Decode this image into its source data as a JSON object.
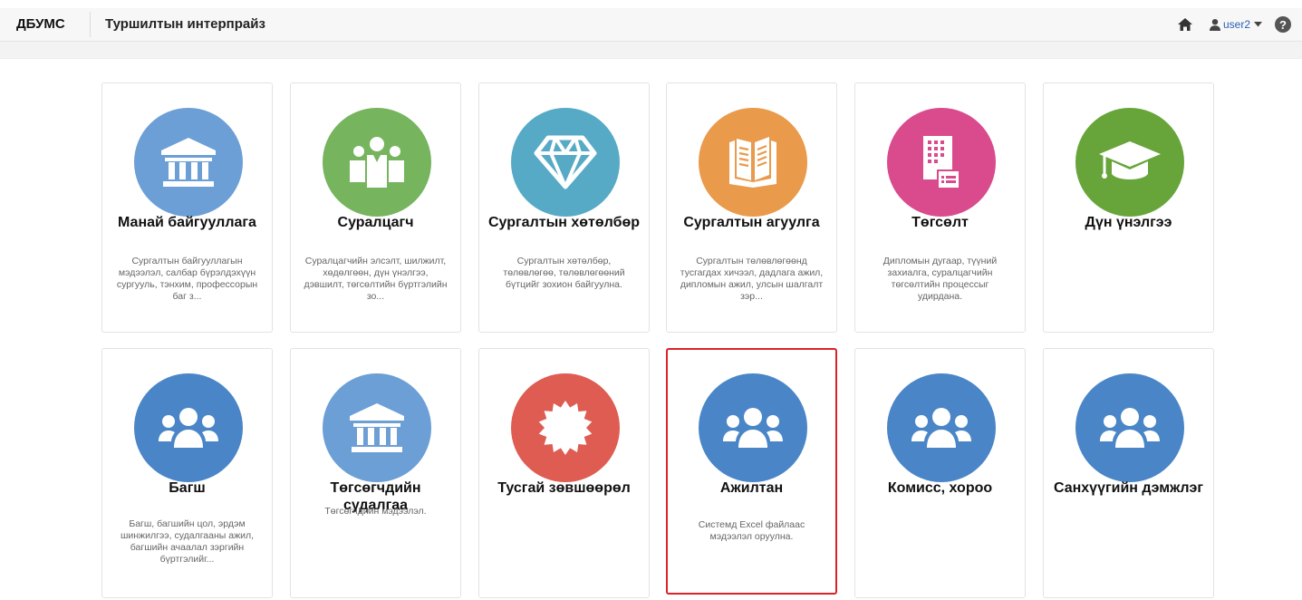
{
  "header": {
    "brand": "ДБУМС",
    "org_name": "Туршилтын интерпрайз",
    "user": "user2",
    "help": "?"
  },
  "colors": {
    "blue": "#4a86c7",
    "light_blue": "#6b9fd6",
    "green": "#76b45e",
    "teal": "#57aac6",
    "orange": "#e99a4a",
    "pink": "#d94b8c",
    "dark_green": "#67a53a",
    "red": "#de5c52",
    "selection_border": "#d9242a"
  },
  "cards": [
    {
      "title": "Манай байгууллага",
      "icon": "institution-icon",
      "color": "#6b9fd6",
      "desc": "Сургалтын байгууллагын мэдээлэл, салбар бүрэлдэхүүн сургууль, тэнхим, профессорын баг з..."
    },
    {
      "title": "Суралцагч",
      "icon": "students-icon",
      "color": "#76b45e",
      "desc": "Суралцагчийн элсэлт, шилжилт, хөдөлгөөн, дүн үнэлгээ, дэвшилт, төгсөлтийн бүртгэлийн зо..."
    },
    {
      "title": "Сургалтын хөтөлбөр",
      "icon": "diamond-icon",
      "color": "#57aac6",
      "desc": "Сургалтын хөтөлбөр, төлөвлөгөө, төлөвлөгөөний бүтцийг зохион байгуулна."
    },
    {
      "title": "Сургалтын агуулга",
      "icon": "book-icon",
      "color": "#e99a4a",
      "desc": "Сургалтын төлөвлөгөөнд тусгагдах хичээл, дадлага ажил, дипломын ажил, улсын шалгалт зэр..."
    },
    {
      "title": "Төгсөлт",
      "icon": "diploma-icon",
      "color": "#d94b8c",
      "desc": "Дипломын дугаар, түүний захиалга, суралцагчийн төгсөлтийн процессыг удирдана."
    },
    {
      "title": "Дүн үнэлгээ",
      "icon": "graduation-cap-icon",
      "color": "#67a53a",
      "desc": ""
    },
    {
      "title": "Багш",
      "icon": "users-icon",
      "color": "#4a86c7",
      "desc": "Багш, багшийн цол, эрдэм шинжилгээ, судалгааны ажил, багшийн ачаалал зэргийн бүртгэлийг..."
    },
    {
      "title": "Төгсөгчдийн судалгаа",
      "icon": "institution-icon",
      "color": "#6b9fd6",
      "desc": "Төгсөгчдийн мэдээлэл."
    },
    {
      "title": "Тусгай зөвшөөрөл",
      "icon": "certificate-icon",
      "color": "#de5c52",
      "desc": ""
    },
    {
      "title": "Ажилтан",
      "icon": "users-icon",
      "color": "#4a86c7",
      "desc": "Системд Excel файлаас мэдээлэл оруулна."
    },
    {
      "title": "Комисс, хороо",
      "icon": "users-icon",
      "color": "#4a86c7",
      "desc": ""
    },
    {
      "title": "Санхүүгийн дэмжлэг",
      "icon": "users-icon",
      "color": "#4a86c7",
      "desc": ""
    }
  ]
}
